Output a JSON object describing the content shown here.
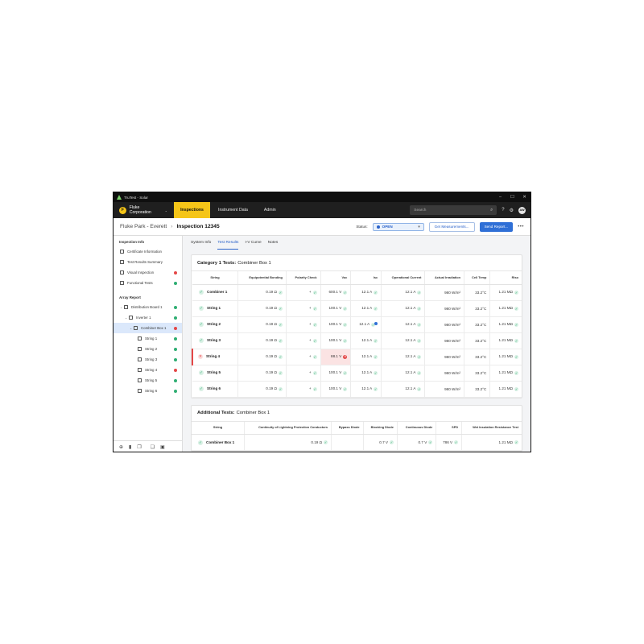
{
  "window": {
    "title": "TruTest - Solar",
    "controls": [
      "–",
      "☐",
      "✕"
    ]
  },
  "nav": {
    "org_initial": "F",
    "org_name": "Fluke Corporation",
    "tabs": [
      "Inspections",
      "Instrument Data",
      "Admin"
    ],
    "search_placeholder": "Search",
    "avatar_initials": "AW"
  },
  "header": {
    "site": "Fluke Park - Everett",
    "inspection": "Inspection 12345",
    "status_label": "Status:",
    "status_value": "OPEN",
    "get_measurements": "Get Measurements...",
    "send_report": "Send Report...",
    "more": "•••"
  },
  "sidebar": {
    "inspection_info_title": "Inspection Info",
    "inspection_items": [
      {
        "label": "Certificate Information",
        "status": ""
      },
      {
        "label": "Test Results Summary",
        "status": ""
      },
      {
        "label": "Visual Inspection",
        "status": "bad"
      },
      {
        "label": "Functional Tests",
        "status": "ok"
      }
    ],
    "array_report_title": "Array Report",
    "array_items": [
      {
        "label": "Distribution Board 1",
        "status": "ok"
      },
      {
        "label": "Inverter 1",
        "status": "ok"
      },
      {
        "label": "Combiner Box 1",
        "status": "bad"
      },
      {
        "label": "String 1",
        "status": "ok"
      },
      {
        "label": "String 2",
        "status": "ok"
      },
      {
        "label": "String 3",
        "status": "ok"
      },
      {
        "label": "String 4",
        "status": "bad"
      },
      {
        "label": "String 5",
        "status": "ok"
      },
      {
        "label": "String 6",
        "status": "ok"
      }
    ]
  },
  "subtabs": [
    "System Info",
    "Test Results",
    "I-V Curve",
    "Notes"
  ],
  "category1": {
    "title_bold": "Category 1 Tests:",
    "title_rest": "Combiner Box 1",
    "headers": [
      "String",
      "Equipotential Bonding",
      "Polarity Check",
      "Voc",
      "Isc",
      "Operational Current",
      "Actual Irradiation",
      "Cell Temp",
      "Riso"
    ],
    "rows": [
      {
        "name": "Combiner 1",
        "bond": "0.19 Ω",
        "pol": "+",
        "voc": "600.1 V",
        "isc": "12.1 A",
        "op": "12.1 A",
        "irr": "980 W/m²",
        "temp": "33.2°C",
        "riso": "1.21 MΩ"
      },
      {
        "name": "String 1",
        "bond": "0.19 Ω",
        "pol": "+",
        "voc": "100.1 V",
        "isc": "12.1 A",
        "op": "12.1 A",
        "irr": "980 W/m²",
        "temp": "33.2°C",
        "riso": "1.21 MΩ"
      },
      {
        "name": "String 2",
        "bond": "0.19 Ω",
        "pol": "+",
        "voc": "100.1 V",
        "isc": "12.1 A",
        "op": "12.1 A",
        "irr": "980 W/m²",
        "temp": "33.2°C",
        "riso": "1.21 MΩ"
      },
      {
        "name": "String 3",
        "bond": "0.19 Ω",
        "pol": "+",
        "voc": "100.1 V",
        "isc": "12.1 A",
        "op": "12.1 A",
        "irr": "980 W/m²",
        "temp": "33.2°C",
        "riso": "1.21 MΩ"
      },
      {
        "name": "String 4",
        "bond": "0.19 Ω",
        "pol": "+",
        "voc": "88.1 V",
        "isc": "12.1 A",
        "op": "12.1 A",
        "irr": "980 W/m²",
        "temp": "33.2°C",
        "riso": "1.21 MΩ"
      },
      {
        "name": "String 5",
        "bond": "0.19 Ω",
        "pol": "+",
        "voc": "100.1 V",
        "isc": "12.1 A",
        "op": "12.1 A",
        "irr": "980 W/m²",
        "temp": "33.2°C",
        "riso": "1.21 MΩ"
      },
      {
        "name": "String 6",
        "bond": "0.19 Ω",
        "pol": "+",
        "voc": "100.1 V",
        "isc": "12.1 A",
        "op": "12.1 A",
        "irr": "980 W/m²",
        "temp": "33.2°C",
        "riso": "1.21 MΩ"
      }
    ]
  },
  "additional": {
    "title_bold": "Additional Tests:",
    "title_rest": "Combiner Box 1",
    "headers": [
      "String",
      "Continuity of Lightning Protection Conductors",
      "Bypass Diode",
      "Blocking Diode",
      "Continuous Diode",
      "SPD",
      "Wet Insulation Resistance Test"
    ],
    "rows": [
      {
        "name": "Combiner Box 1",
        "cont": "0.19 Ω",
        "bypass": "",
        "block": "0.7 V",
        "contd": "0.7 V",
        "spd": "786 V",
        "wet": "1.21 MΩ"
      }
    ]
  }
}
